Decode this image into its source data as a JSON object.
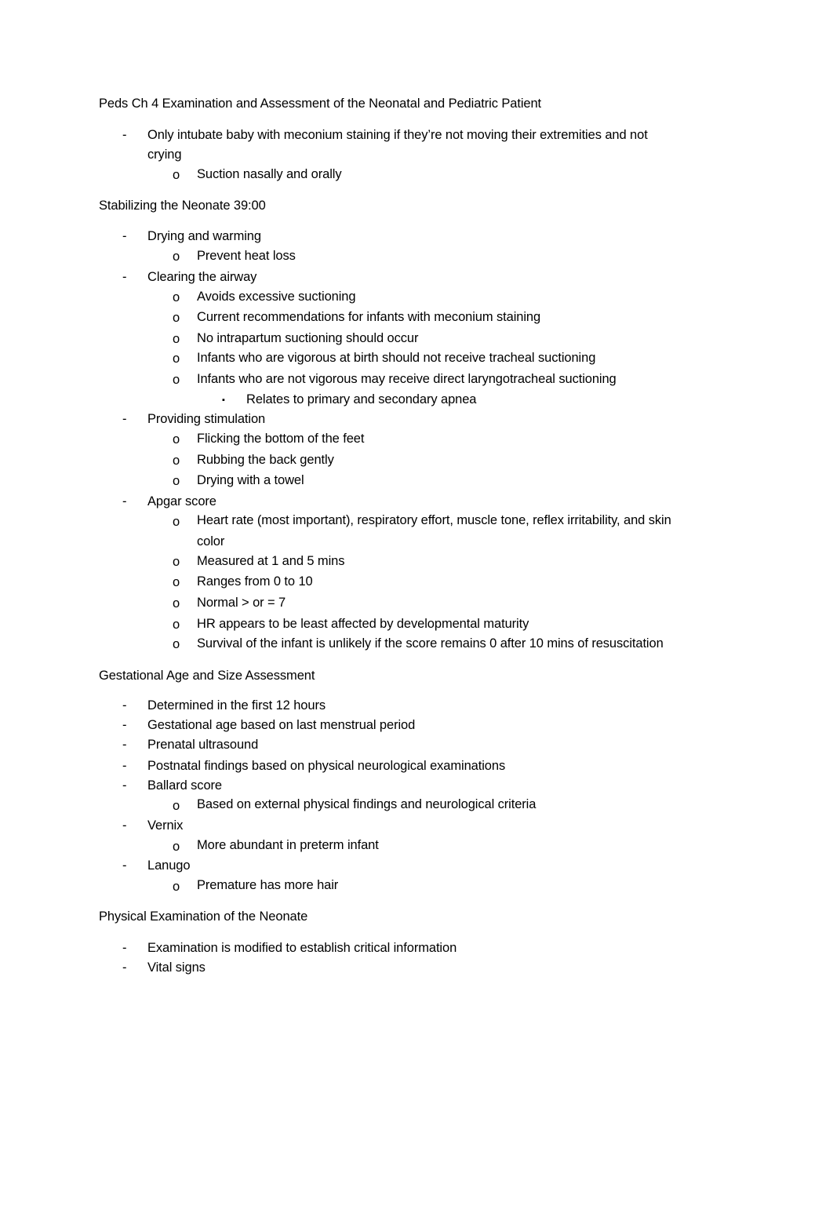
{
  "document": {
    "title": "Peds Ch 4 Examination and Assessment of the Neonatal and Pediatric Patient",
    "bullets": {
      "dash": "-",
      "circle": "o",
      "square": "▪"
    },
    "intro": [
      {
        "text": "Only intubate baby with meconium staining if they’re not moving their extremities and not",
        "cont": "crying",
        "children": [
          {
            "text": "Suction nasally and orally"
          }
        ]
      }
    ],
    "sections": [
      {
        "heading": "Stabilizing the Neonate 39:00",
        "items": [
          {
            "text": "Drying and warming",
            "children": [
              {
                "text": "Prevent heat loss"
              }
            ]
          },
          {
            "text": "Clearing the airway",
            "children": [
              {
                "text": "Avoids excessive suctioning"
              },
              {
                "text": "Current recommendations for infants with meconium staining"
              },
              {
                "text": "No intrapartum suctioning should occur"
              },
              {
                "text": "Infants who are vigorous at birth should not receive tracheal suctioning"
              },
              {
                "text": "Infants who are not vigorous may receive direct laryngotracheal suctioning",
                "children": [
                  {
                    "text": "Relates to primary and secondary apnea"
                  }
                ]
              }
            ]
          },
          {
            "text": "Providing stimulation",
            "children": [
              {
                "text": "Flicking the bottom of the feet"
              },
              {
                "text": "Rubbing the back gently"
              },
              {
                "text": "Drying with a towel"
              }
            ]
          },
          {
            "text": "Apgar score",
            "children": [
              {
                "text": "Heart rate (most important), respiratory effort, muscle tone, reflex irritability, and skin",
                "cont": "color"
              },
              {
                "text": "Measured at 1 and 5 mins"
              },
              {
                "text": "Ranges from 0 to 10"
              },
              {
                "text": "Normal > or = 7"
              },
              {
                "text": "HR appears to be least affected by developmental maturity"
              },
              {
                "text": "Survival of the infant is unlikely if the score remains 0 after 10 mins of resuscitation"
              }
            ]
          }
        ]
      },
      {
        "heading": "Gestational Age and Size Assessment",
        "items": [
          {
            "text": "Determined in the first 12 hours"
          },
          {
            "text": "Gestational age based on last menstrual period"
          },
          {
            "text": "Prenatal ultrasound"
          },
          {
            "text": "Postnatal findings based on physical neurological examinations"
          },
          {
            "text": "Ballard score",
            "children": [
              {
                "text": "Based on external physical findings and neurological criteria"
              }
            ]
          },
          {
            "text": "Vernix",
            "children": [
              {
                "text": "More abundant in preterm infant"
              }
            ]
          },
          {
            "text": "Lanugo",
            "children": [
              {
                "text": "Premature has more hair"
              }
            ]
          }
        ]
      },
      {
        "heading": "Physical Examination of the Neonate",
        "items": [
          {
            "text": "Examination is modified to establish critical information"
          },
          {
            "text": "Vital signs"
          }
        ]
      }
    ]
  }
}
